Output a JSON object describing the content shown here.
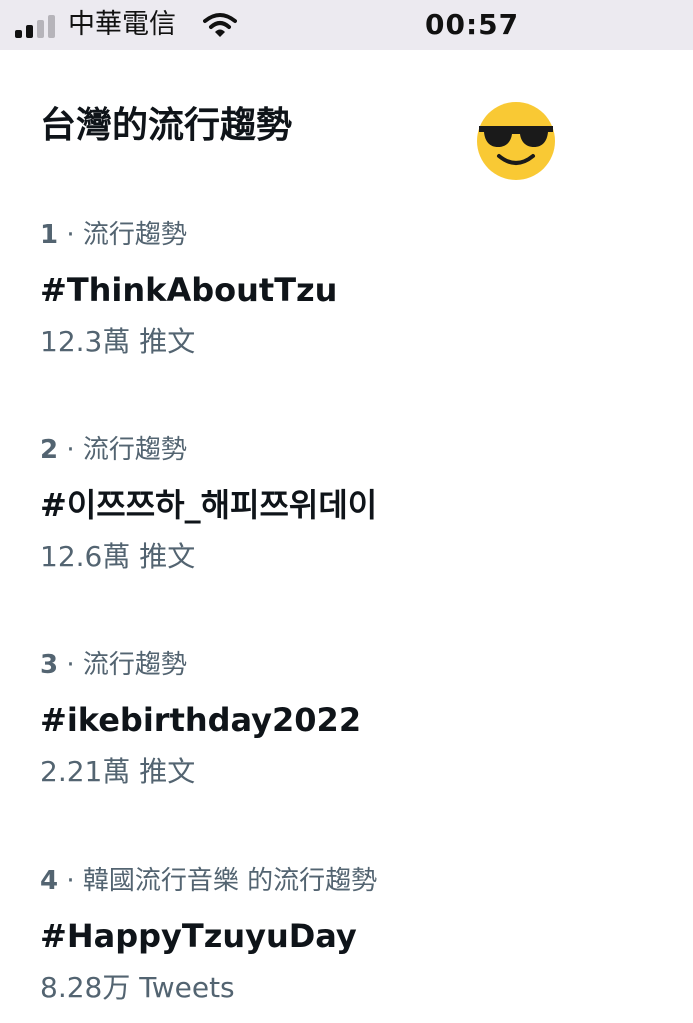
{
  "status_bar": {
    "carrier": "中華電信",
    "time": "00:57",
    "signal_bars_filled": 2,
    "signal_bars_total": 4,
    "icons": [
      "signal-icon",
      "wifi-icon"
    ]
  },
  "header": {
    "title": "台灣的流行趨勢",
    "emoji_icon": "smiling-face-with-sunglasses-icon"
  },
  "trends": [
    {
      "rank": "1",
      "separator": " · ",
      "context": "流行趨勢",
      "name": "#ThinkAboutTzu",
      "count": "12.3萬 推文"
    },
    {
      "rank": "2",
      "separator": " · ",
      "context": "流行趨勢",
      "name": "#이쯔쯔하_해피쯔위데이",
      "count": "12.6萬 推文"
    },
    {
      "rank": "3",
      "separator": " · ",
      "context": "流行趨勢",
      "name": "#ikebirthday2022",
      "count": "2.21萬 推文"
    },
    {
      "rank": "4",
      "separator": " · ",
      "context": "韓國流行音樂 的流行趨勢",
      "name": "#HappyTzuyuDay",
      "count": "8.28万 Tweets"
    }
  ],
  "colors": {
    "status_bar_bg": "#eceaf0",
    "primary_text": "#0f1419",
    "secondary_text": "#536471",
    "emoji_face": "#f9c934",
    "emoji_glasses": "#1a1a1a"
  }
}
